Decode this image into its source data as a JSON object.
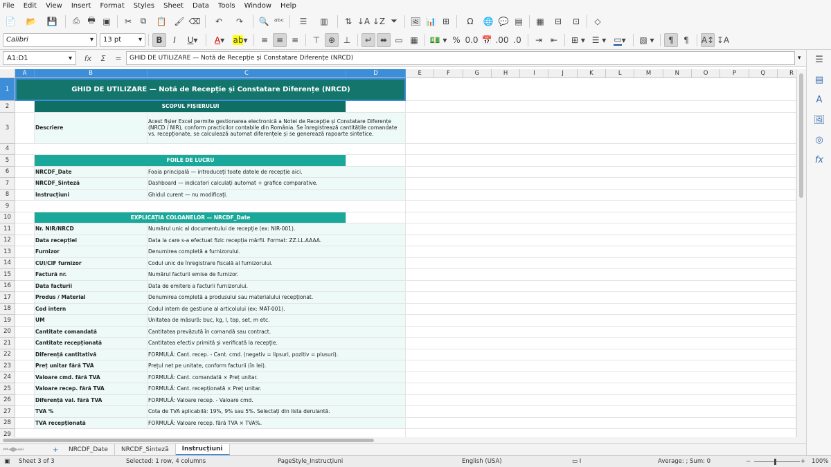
{
  "menu": [
    "File",
    "Edit",
    "View",
    "Insert",
    "Format",
    "Styles",
    "Sheet",
    "Data",
    "Tools",
    "Window",
    "Help"
  ],
  "format_bar": {
    "font_name": "Calibri",
    "font_size": "13 pt"
  },
  "formula_bar": {
    "name_box": "A1:D1",
    "content": "GHID DE UTILIZARE — Notă de Recepție și Constatare Diferențe (NRCD)",
    "fx": "fx",
    "sigma": "Σ",
    "equals": "="
  },
  "columns": [
    "A",
    "B",
    "C",
    "D",
    "E",
    "F",
    "G",
    "H",
    "I",
    "J",
    "K",
    "L",
    "M",
    "N",
    "O",
    "P",
    "Q",
    "R"
  ],
  "rows": [
    {
      "n": "1",
      "title": "GHID DE UTILIZARE — Notă de Recepție și Constatare Diferențe (NRCD)"
    },
    {
      "n": "2",
      "section": "SCOPUL FIȘIERULUI",
      "style": "dark"
    },
    {
      "n": "3",
      "b": "Descriere",
      "c": "Acest fișier Excel permite gestionarea electronică a Notei de Recepție și Constatare Diferențe (NRCD / NIR), conform practicilor contabile din România. Se înregistrează cantitățile comandate vs. recepționate, se calculează automat diferențele și se generează rapoarte sintetice."
    },
    {
      "n": "4"
    },
    {
      "n": "5",
      "section": "FOILE DE LUCRU",
      "style": "mid"
    },
    {
      "n": "6",
      "b": "NRCDF_Date",
      "c": "Foaia principală — introduceți toate datele de recepție aici."
    },
    {
      "n": "7",
      "b": "NRCDF_Sinteză",
      "c": "Dashboard — indicatori calculați automat + grafice comparative."
    },
    {
      "n": "8",
      "b": "Instrucțiuni",
      "c": "Ghidul curent — nu modificați."
    },
    {
      "n": "9"
    },
    {
      "n": "10",
      "section": "EXPLICAȚIA COLOANELOR — NRCDF_Date",
      "style": "mid"
    },
    {
      "n": "11",
      "b": "Nr. NIR/NRCD",
      "c": "Numărul unic al documentului de recepție (ex: NIR-001)."
    },
    {
      "n": "12",
      "b": "Data recepției",
      "c": "Data la care s-a efectuat fizic recepția mărfii. Format: ZZ.LL.AAAA."
    },
    {
      "n": "13",
      "b": "Furnizor",
      "c": "Denumirea completă a furnizorului."
    },
    {
      "n": "14",
      "b": "CUI/CIF furnizor",
      "c": "Codul unic de înregistrare fiscală al furnizorului."
    },
    {
      "n": "15",
      "b": "Factură nr.",
      "c": "Numărul facturii emise de furnizor."
    },
    {
      "n": "16",
      "b": "Data facturii",
      "c": "Data de emitere a facturii furnizorului."
    },
    {
      "n": "17",
      "b": "Produs / Material",
      "c": "Denumirea completă a produsului sau materialului recepționat."
    },
    {
      "n": "18",
      "b": "Cod intern",
      "c": "Codul intern de gestiune al articolului (ex: MAT-001)."
    },
    {
      "n": "19",
      "b": "UM",
      "c": "Unitatea de măsură: buc, kg, l, top, set, m etc."
    },
    {
      "n": "20",
      "b": "Cantitate comandată",
      "c": "Cantitatea prevăzută în comandă sau contract."
    },
    {
      "n": "21",
      "b": "Cantitate recepționată",
      "c": "Cantitatea efectiv primită și verificată la recepție."
    },
    {
      "n": "22",
      "b": "Diferență cantitativă",
      "c": "FORMULĂ: Cant. recep. - Cant. cmd. (negativ = lipsuri, pozitiv = plusuri)."
    },
    {
      "n": "23",
      "b": "Preț unitar fără TVA",
      "c": "Prețul net pe unitate, conform facturii (în lei)."
    },
    {
      "n": "24",
      "b": "Valoare cmd. fără TVA",
      "c": "FORMULĂ: Cant. comandată × Preț unitar."
    },
    {
      "n": "25",
      "b": "Valoare recep. fără TVA",
      "c": "FORMULĂ: Cant. recepționată × Preț unitar."
    },
    {
      "n": "26",
      "b": "Diferență val. fără TVA",
      "c": "FORMULĂ: Valoare recep. - Valoare cmd."
    },
    {
      "n": "27",
      "b": "TVA %",
      "c": "Cota de TVA aplicabilă: 19%, 9% sau 5%. Selectați din lista derulantă."
    },
    {
      "n": "28",
      "b": "TVA recepționată",
      "c": "FORMULĂ: Valoare recep. fără TVA × TVA%."
    },
    {
      "n": "29"
    }
  ],
  "sheets": [
    "NRCDF_Date",
    "NRCDF_Sinteză",
    "Instrucțiuni"
  ],
  "active_sheet": "Instrucțiuni",
  "status": {
    "sheet": "Sheet 3 of 3",
    "selection": "Selected: 1 row, 4 columns",
    "page_style": "PageStyle_Instrucțiuni",
    "language": "English (USA)",
    "sum": "Average: ; Sum: 0",
    "zoom": "100%"
  },
  "colors": {
    "title": "#13756b",
    "section_dark": "#0f6f65",
    "section_mid": "#1aa89a",
    "row_tint": "#eefaf8",
    "selection": "#3c8ed8"
  }
}
